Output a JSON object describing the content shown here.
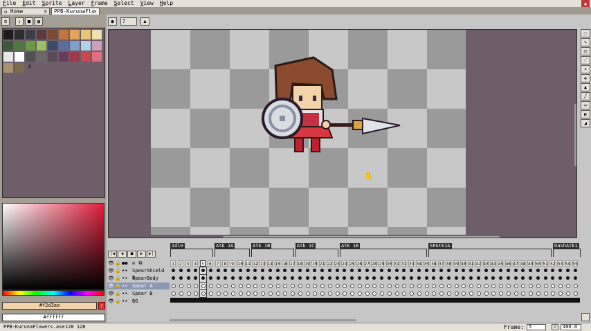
{
  "menu": [
    "File",
    "Edit",
    "Sprite",
    "Layer",
    "Frame",
    "Select",
    "View",
    "Help"
  ],
  "tabs": [
    {
      "label": "Home",
      "close": "×",
      "active": false
    },
    {
      "label": "PPB-KurunaFlo",
      "close": "×",
      "active": true
    }
  ],
  "context": {
    "brush_size": "7"
  },
  "palette": {
    "colors": [
      "#1b1b1b",
      "#2d2d2d",
      "#3d3d4a",
      "#5a3a3a",
      "#7a4a33",
      "#c2763b",
      "#e0a45f",
      "#e6c679",
      "#f0e2b0",
      "#3d5a38",
      "#4d7a3c",
      "#6a9a44",
      "#9bc260",
      "#3a4a6d",
      "#5a6fa0",
      "#7fa0c8",
      "#b0d0e8",
      "#d0a0c0",
      "#e8e8e8",
      "#ffffff",
      "#505050",
      "#6a6a6a",
      "#5a4a5a",
      "#6a3a5a",
      "#9a3a4a",
      "#c24a50",
      "#e07080",
      "#a89070",
      "#7a6a50"
    ],
    "extra_label": "8"
  },
  "colors": {
    "fg_label": "#f2d3aa",
    "fg_value": "#f2d3aa",
    "bg_label": "#ffffff",
    "bg_value": "#ffffff"
  },
  "timeline": {
    "tags": [
      {
        "label": "Idle"
      },
      {
        "label": "Atk 1A"
      },
      {
        "label": "Atk 1B"
      },
      {
        "label": "Atk 1C"
      },
      {
        "label": "Atk 1E"
      },
      {
        "label": "SPAtk1A"
      },
      {
        "label": "DashAtk1"
      }
    ],
    "frames": [
      "1",
      "2",
      "3",
      "4",
      "5",
      "6",
      "7",
      "8",
      "9",
      "10",
      "11",
      "12",
      "13",
      "14",
      "15",
      "16",
      "17",
      "18",
      "19",
      "20",
      "21",
      "22",
      "23",
      "24",
      "25",
      "26",
      "27",
      "28",
      "29",
      "30",
      "31",
      "32",
      "33",
      "34",
      "35",
      "36",
      "37",
      "38",
      "39",
      "40",
      "41",
      "42",
      "43",
      "44",
      "45",
      "46",
      "47",
      "48",
      "49",
      "50",
      "51",
      "52",
      "53",
      "54",
      "55"
    ],
    "current_frame": "5",
    "layers": [
      {
        "name": "SpearShield B",
        "selected": false
      },
      {
        "name": "SpearBody",
        "selected": false
      },
      {
        "name": "Spear A",
        "selected": true
      },
      {
        "name": "Spear B",
        "selected": false
      },
      {
        "name": "BG",
        "selected": false
      }
    ]
  },
  "status": {
    "file": "PPB-KurunaFlowers.ase",
    "size": "128 128",
    "frame_label": "Frame:",
    "frame_value": "5",
    "zoom": "400.0"
  }
}
